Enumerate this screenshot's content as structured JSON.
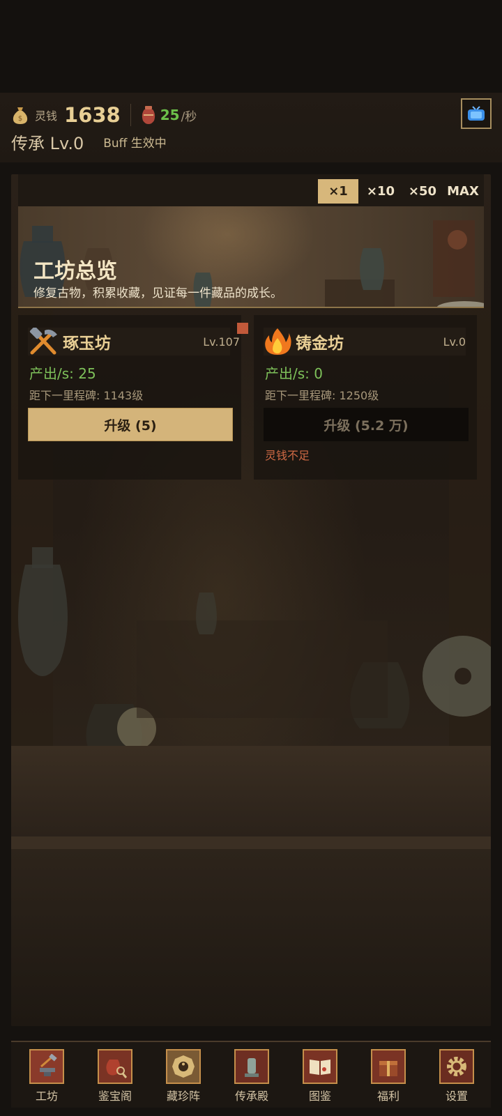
{
  "resources": {
    "coin_label": "灵钱",
    "coin_value": "1638",
    "rate_value": "25",
    "rate_unit": "/秒",
    "coin_icon": "money-bag-icon",
    "rate_icon": "vase-icon",
    "tv_icon": "tv-icon"
  },
  "legacy": {
    "level_text": "传承 Lv.0",
    "mark": "",
    "buff_text": "Buff 生效中"
  },
  "multipliers": {
    "options": [
      "×1",
      "×10",
      "×50",
      "MAX"
    ],
    "selected": "×1"
  },
  "banner": {
    "title": "工坊总览",
    "subtitle": "修复古物，积累收藏，见证每一件藏品的成长。"
  },
  "workshops": [
    {
      "name": "琢玉坊",
      "level": "Lv.107",
      "icon": "hammer-pick-icon",
      "rate": "产出/s: 25",
      "milestone": "距下一里程碑: 1143级",
      "upgrade_label": "升级 (5)",
      "warning": "",
      "notice": true
    },
    {
      "name": "铸金坊",
      "level": "Lv.0",
      "icon": "fire-icon",
      "rate": "产出/s: 0",
      "milestone": "距下一里程碑: 1250级",
      "upgrade_label": "升级 (5.2 万)",
      "warning": "灵钱不足",
      "notice": false
    }
  ],
  "nav": {
    "items": [
      {
        "label": "工坊",
        "icon": "anvil-icon"
      },
      {
        "label": "鉴宝阁",
        "icon": "pot-magnifier-icon"
      },
      {
        "label": "藏珍阵",
        "icon": "bagua-icon"
      },
      {
        "label": "传承殿",
        "icon": "stele-icon"
      },
      {
        "label": "图鉴",
        "icon": "book-icon"
      },
      {
        "label": "福利",
        "icon": "gift-chest-icon"
      },
      {
        "label": "设置",
        "icon": "gear-icon"
      }
    ]
  },
  "colors": {
    "accent_gold": "#d4b47a",
    "rate_green": "#6cc04a",
    "warning_red": "#d06a45",
    "background": "#15120f"
  }
}
